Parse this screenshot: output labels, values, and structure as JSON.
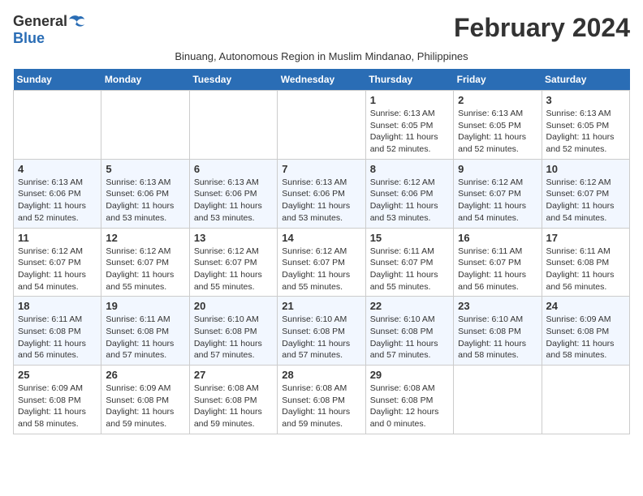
{
  "logo": {
    "general": "General",
    "blue": "Blue"
  },
  "title": "February 2024",
  "subtitle": "Binuang, Autonomous Region in Muslim Mindanao, Philippines",
  "header": {
    "days": [
      "Sunday",
      "Monday",
      "Tuesday",
      "Wednesday",
      "Thursday",
      "Friday",
      "Saturday"
    ]
  },
  "weeks": [
    [
      {
        "day": "",
        "info": ""
      },
      {
        "day": "",
        "info": ""
      },
      {
        "day": "",
        "info": ""
      },
      {
        "day": "",
        "info": ""
      },
      {
        "day": "1",
        "info": "Sunrise: 6:13 AM\nSunset: 6:05 PM\nDaylight: 11 hours and 52 minutes."
      },
      {
        "day": "2",
        "info": "Sunrise: 6:13 AM\nSunset: 6:05 PM\nDaylight: 11 hours and 52 minutes."
      },
      {
        "day": "3",
        "info": "Sunrise: 6:13 AM\nSunset: 6:05 PM\nDaylight: 11 hours and 52 minutes."
      }
    ],
    [
      {
        "day": "4",
        "info": "Sunrise: 6:13 AM\nSunset: 6:06 PM\nDaylight: 11 hours and 52 minutes."
      },
      {
        "day": "5",
        "info": "Sunrise: 6:13 AM\nSunset: 6:06 PM\nDaylight: 11 hours and 53 minutes."
      },
      {
        "day": "6",
        "info": "Sunrise: 6:13 AM\nSunset: 6:06 PM\nDaylight: 11 hours and 53 minutes."
      },
      {
        "day": "7",
        "info": "Sunrise: 6:13 AM\nSunset: 6:06 PM\nDaylight: 11 hours and 53 minutes."
      },
      {
        "day": "8",
        "info": "Sunrise: 6:12 AM\nSunset: 6:06 PM\nDaylight: 11 hours and 53 minutes."
      },
      {
        "day": "9",
        "info": "Sunrise: 6:12 AM\nSunset: 6:07 PM\nDaylight: 11 hours and 54 minutes."
      },
      {
        "day": "10",
        "info": "Sunrise: 6:12 AM\nSunset: 6:07 PM\nDaylight: 11 hours and 54 minutes."
      }
    ],
    [
      {
        "day": "11",
        "info": "Sunrise: 6:12 AM\nSunset: 6:07 PM\nDaylight: 11 hours and 54 minutes."
      },
      {
        "day": "12",
        "info": "Sunrise: 6:12 AM\nSunset: 6:07 PM\nDaylight: 11 hours and 55 minutes."
      },
      {
        "day": "13",
        "info": "Sunrise: 6:12 AM\nSunset: 6:07 PM\nDaylight: 11 hours and 55 minutes."
      },
      {
        "day": "14",
        "info": "Sunrise: 6:12 AM\nSunset: 6:07 PM\nDaylight: 11 hours and 55 minutes."
      },
      {
        "day": "15",
        "info": "Sunrise: 6:11 AM\nSunset: 6:07 PM\nDaylight: 11 hours and 55 minutes."
      },
      {
        "day": "16",
        "info": "Sunrise: 6:11 AM\nSunset: 6:07 PM\nDaylight: 11 hours and 56 minutes."
      },
      {
        "day": "17",
        "info": "Sunrise: 6:11 AM\nSunset: 6:08 PM\nDaylight: 11 hours and 56 minutes."
      }
    ],
    [
      {
        "day": "18",
        "info": "Sunrise: 6:11 AM\nSunset: 6:08 PM\nDaylight: 11 hours and 56 minutes."
      },
      {
        "day": "19",
        "info": "Sunrise: 6:11 AM\nSunset: 6:08 PM\nDaylight: 11 hours and 57 minutes."
      },
      {
        "day": "20",
        "info": "Sunrise: 6:10 AM\nSunset: 6:08 PM\nDaylight: 11 hours and 57 minutes."
      },
      {
        "day": "21",
        "info": "Sunrise: 6:10 AM\nSunset: 6:08 PM\nDaylight: 11 hours and 57 minutes."
      },
      {
        "day": "22",
        "info": "Sunrise: 6:10 AM\nSunset: 6:08 PM\nDaylight: 11 hours and 57 minutes."
      },
      {
        "day": "23",
        "info": "Sunrise: 6:10 AM\nSunset: 6:08 PM\nDaylight: 11 hours and 58 minutes."
      },
      {
        "day": "24",
        "info": "Sunrise: 6:09 AM\nSunset: 6:08 PM\nDaylight: 11 hours and 58 minutes."
      }
    ],
    [
      {
        "day": "25",
        "info": "Sunrise: 6:09 AM\nSunset: 6:08 PM\nDaylight: 11 hours and 58 minutes."
      },
      {
        "day": "26",
        "info": "Sunrise: 6:09 AM\nSunset: 6:08 PM\nDaylight: 11 hours and 59 minutes."
      },
      {
        "day": "27",
        "info": "Sunrise: 6:08 AM\nSunset: 6:08 PM\nDaylight: 11 hours and 59 minutes."
      },
      {
        "day": "28",
        "info": "Sunrise: 6:08 AM\nSunset: 6:08 PM\nDaylight: 11 hours and 59 minutes."
      },
      {
        "day": "29",
        "info": "Sunrise: 6:08 AM\nSunset: 6:08 PM\nDaylight: 12 hours and 0 minutes."
      },
      {
        "day": "",
        "info": ""
      },
      {
        "day": "",
        "info": ""
      }
    ]
  ]
}
